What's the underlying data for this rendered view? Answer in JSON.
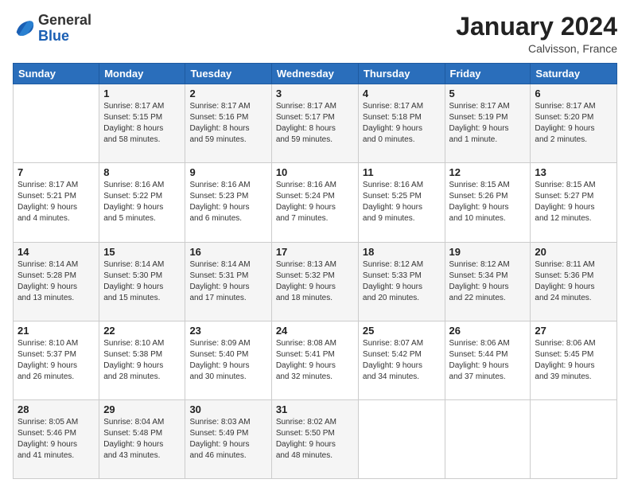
{
  "header": {
    "logo": {
      "general": "General",
      "blue": "Blue"
    },
    "title": "January 2024",
    "location": "Calvisson, France"
  },
  "calendar": {
    "headers": [
      "Sunday",
      "Monday",
      "Tuesday",
      "Wednesday",
      "Thursday",
      "Friday",
      "Saturday"
    ],
    "weeks": [
      [
        {
          "day": "",
          "info": ""
        },
        {
          "day": "1",
          "info": "Sunrise: 8:17 AM\nSunset: 5:15 PM\nDaylight: 8 hours\nand 58 minutes."
        },
        {
          "day": "2",
          "info": "Sunrise: 8:17 AM\nSunset: 5:16 PM\nDaylight: 8 hours\nand 59 minutes."
        },
        {
          "day": "3",
          "info": "Sunrise: 8:17 AM\nSunset: 5:17 PM\nDaylight: 8 hours\nand 59 minutes."
        },
        {
          "day": "4",
          "info": "Sunrise: 8:17 AM\nSunset: 5:18 PM\nDaylight: 9 hours\nand 0 minutes."
        },
        {
          "day": "5",
          "info": "Sunrise: 8:17 AM\nSunset: 5:19 PM\nDaylight: 9 hours\nand 1 minute."
        },
        {
          "day": "6",
          "info": "Sunrise: 8:17 AM\nSunset: 5:20 PM\nDaylight: 9 hours\nand 2 minutes."
        }
      ],
      [
        {
          "day": "7",
          "info": "Sunrise: 8:17 AM\nSunset: 5:21 PM\nDaylight: 9 hours\nand 4 minutes."
        },
        {
          "day": "8",
          "info": "Sunrise: 8:16 AM\nSunset: 5:22 PM\nDaylight: 9 hours\nand 5 minutes."
        },
        {
          "day": "9",
          "info": "Sunrise: 8:16 AM\nSunset: 5:23 PM\nDaylight: 9 hours\nand 6 minutes."
        },
        {
          "day": "10",
          "info": "Sunrise: 8:16 AM\nSunset: 5:24 PM\nDaylight: 9 hours\nand 7 minutes."
        },
        {
          "day": "11",
          "info": "Sunrise: 8:16 AM\nSunset: 5:25 PM\nDaylight: 9 hours\nand 9 minutes."
        },
        {
          "day": "12",
          "info": "Sunrise: 8:15 AM\nSunset: 5:26 PM\nDaylight: 9 hours\nand 10 minutes."
        },
        {
          "day": "13",
          "info": "Sunrise: 8:15 AM\nSunset: 5:27 PM\nDaylight: 9 hours\nand 12 minutes."
        }
      ],
      [
        {
          "day": "14",
          "info": "Sunrise: 8:14 AM\nSunset: 5:28 PM\nDaylight: 9 hours\nand 13 minutes."
        },
        {
          "day": "15",
          "info": "Sunrise: 8:14 AM\nSunset: 5:30 PM\nDaylight: 9 hours\nand 15 minutes."
        },
        {
          "day": "16",
          "info": "Sunrise: 8:14 AM\nSunset: 5:31 PM\nDaylight: 9 hours\nand 17 minutes."
        },
        {
          "day": "17",
          "info": "Sunrise: 8:13 AM\nSunset: 5:32 PM\nDaylight: 9 hours\nand 18 minutes."
        },
        {
          "day": "18",
          "info": "Sunrise: 8:12 AM\nSunset: 5:33 PM\nDaylight: 9 hours\nand 20 minutes."
        },
        {
          "day": "19",
          "info": "Sunrise: 8:12 AM\nSunset: 5:34 PM\nDaylight: 9 hours\nand 22 minutes."
        },
        {
          "day": "20",
          "info": "Sunrise: 8:11 AM\nSunset: 5:36 PM\nDaylight: 9 hours\nand 24 minutes."
        }
      ],
      [
        {
          "day": "21",
          "info": "Sunrise: 8:10 AM\nSunset: 5:37 PM\nDaylight: 9 hours\nand 26 minutes."
        },
        {
          "day": "22",
          "info": "Sunrise: 8:10 AM\nSunset: 5:38 PM\nDaylight: 9 hours\nand 28 minutes."
        },
        {
          "day": "23",
          "info": "Sunrise: 8:09 AM\nSunset: 5:40 PM\nDaylight: 9 hours\nand 30 minutes."
        },
        {
          "day": "24",
          "info": "Sunrise: 8:08 AM\nSunset: 5:41 PM\nDaylight: 9 hours\nand 32 minutes."
        },
        {
          "day": "25",
          "info": "Sunrise: 8:07 AM\nSunset: 5:42 PM\nDaylight: 9 hours\nand 34 minutes."
        },
        {
          "day": "26",
          "info": "Sunrise: 8:06 AM\nSunset: 5:44 PM\nDaylight: 9 hours\nand 37 minutes."
        },
        {
          "day": "27",
          "info": "Sunrise: 8:06 AM\nSunset: 5:45 PM\nDaylight: 9 hours\nand 39 minutes."
        }
      ],
      [
        {
          "day": "28",
          "info": "Sunrise: 8:05 AM\nSunset: 5:46 PM\nDaylight: 9 hours\nand 41 minutes."
        },
        {
          "day": "29",
          "info": "Sunrise: 8:04 AM\nSunset: 5:48 PM\nDaylight: 9 hours\nand 43 minutes."
        },
        {
          "day": "30",
          "info": "Sunrise: 8:03 AM\nSunset: 5:49 PM\nDaylight: 9 hours\nand 46 minutes."
        },
        {
          "day": "31",
          "info": "Sunrise: 8:02 AM\nSunset: 5:50 PM\nDaylight: 9 hours\nand 48 minutes."
        },
        {
          "day": "",
          "info": ""
        },
        {
          "day": "",
          "info": ""
        },
        {
          "day": "",
          "info": ""
        }
      ]
    ]
  }
}
